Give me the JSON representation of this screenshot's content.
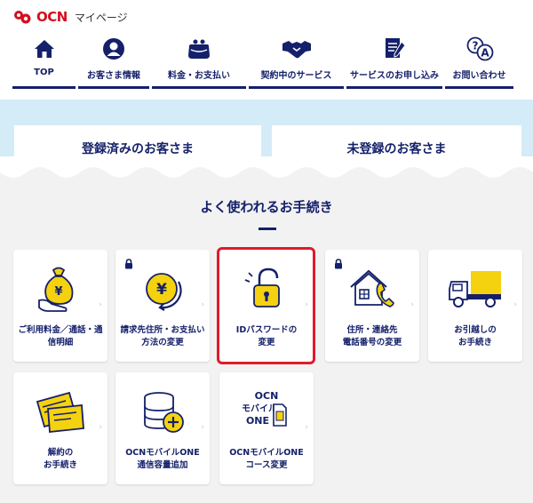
{
  "header": {
    "brand": "OCN",
    "sub_title": "マイページ"
  },
  "nav": [
    {
      "label": "TOP",
      "icon": "home-icon"
    },
    {
      "label": "お客さま情報",
      "icon": "user-icon"
    },
    {
      "label": "料金・お支払い",
      "icon": "wallet-icon"
    },
    {
      "label": "契約中のサービス",
      "icon": "handshake-icon"
    },
    {
      "label": "サービスのお申し込み",
      "icon": "document-pen-icon"
    },
    {
      "label": "お問い合わせ",
      "icon": "question-answer-icon"
    }
  ],
  "registration": {
    "registered": "登録済みのお客さま",
    "unregistered": "未登録のお客さま"
  },
  "section_title": "よく使われるお手続き",
  "cards": [
    {
      "line1": "ご利用料金／通話・通",
      "line2": "信明細",
      "icon": "money-bag-icon",
      "locked": false
    },
    {
      "line1": "請求先住所・お支払い",
      "line2": "方法の変更",
      "icon": "yen-coin-icon",
      "locked": true
    },
    {
      "line1": "IDパスワードの",
      "line2": "変更",
      "icon": "padlock-icon",
      "locked": false,
      "highlighted": true
    },
    {
      "line1": "住所・連絡先",
      "line2": "電話番号の変更",
      "icon": "house-phone-icon",
      "locked": true
    },
    {
      "line1": "お引越しの",
      "line2": "お手続き",
      "icon": "moving-truck-icon",
      "locked": false
    },
    {
      "line1": "解約の",
      "line2": "お手続き",
      "icon": "tickets-icon",
      "locked": false
    },
    {
      "line1": "OCNモバイルONE",
      "line2": "通信容量追加",
      "icon": "data-add-icon",
      "locked": false
    },
    {
      "line1": "OCNモバイルONE",
      "line2": "コース変更",
      "icon": "sim-card-icon",
      "locked": false,
      "badge_line1": "OCN",
      "badge_line2": "モバイル",
      "badge_line3": "ONE"
    }
  ],
  "colors": {
    "navy": "#14206a",
    "accent_yellow": "#f4d20f",
    "brand_red": "#d40f1d",
    "band_blue": "#d4ecf7",
    "highlight_red": "#e01b2b"
  }
}
